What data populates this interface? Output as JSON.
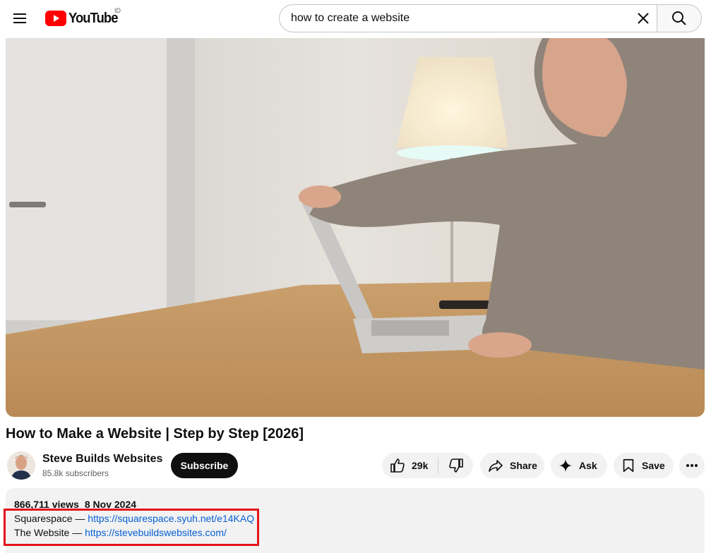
{
  "header": {
    "logo_text": "YouTube",
    "region_code": "ID",
    "search": {
      "value": "how to create a website",
      "placeholder": "Search"
    },
    "brand_color": "#FF0000"
  },
  "video": {
    "title": "How to Make a Website | Step by Step [2026]",
    "channel_name": "Steve Builds Websites",
    "subscribers": "85.8k subscribers",
    "subscribe_label": "Subscribe",
    "actions": {
      "like_count": "29k",
      "share_label": "Share",
      "ask_label": "Ask",
      "save_label": "Save"
    }
  },
  "description": {
    "views": "866,711 views",
    "date": "8 Nov 2024",
    "links": [
      {
        "label": "Squarespace — ",
        "url": "https://squarespace.syuh.net/e14KAQ"
      },
      {
        "label": "The Website — ",
        "url": "https://stevebuildswebsites.com/"
      }
    ]
  },
  "colors": {
    "link": "#065fd4",
    "highlight_box": "#e3141b"
  }
}
